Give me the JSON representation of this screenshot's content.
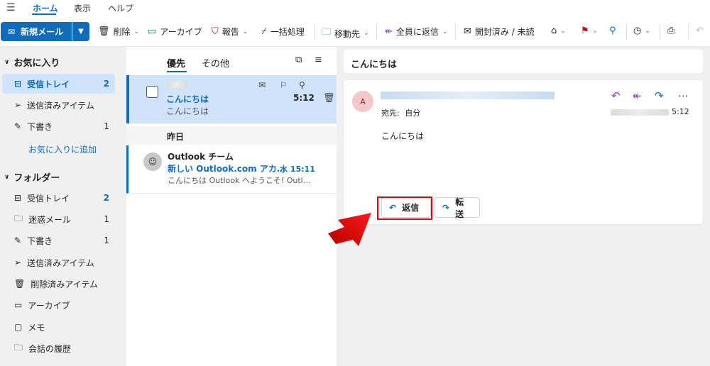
{
  "menu": {
    "tabs": [
      "ホーム",
      "表示",
      "ヘルプ"
    ]
  },
  "toolbar": {
    "new_mail": "新規メール",
    "delete": "削除",
    "archive": "アーカイブ",
    "report": "報告",
    "sweep": "一括処理",
    "move_to": "移動先",
    "reply_all": "全員に返信",
    "read_unread": "開封済み / 未読"
  },
  "sidebar": {
    "favorites_title": "お気に入り",
    "favorites": [
      {
        "label": "受信トレイ",
        "count": "2"
      },
      {
        "label": "送信済みアイテム",
        "count": ""
      },
      {
        "label": "下書き",
        "count": "1"
      }
    ],
    "add_favorite": "お気に入りに追加",
    "folders_title": "フォルダー",
    "folders": [
      {
        "label": "受信トレイ",
        "count": "2"
      },
      {
        "label": "迷惑メール",
        "count": "1"
      },
      {
        "label": "下書き",
        "count": "1"
      },
      {
        "label": "送信済みアイテム",
        "count": ""
      },
      {
        "label": "削除済みアイテム",
        "count": ""
      },
      {
        "label": "アーカイブ",
        "count": ""
      },
      {
        "label": "メモ",
        "count": ""
      },
      {
        "label": "会話の履歴",
        "count": ""
      }
    ]
  },
  "list": {
    "tab_focused": "優先",
    "tab_other": "その他",
    "msg1": {
      "subject": "こんにちは",
      "preview": "こんにちは",
      "time": "5:12"
    },
    "day_separator": "昨日",
    "msg2": {
      "sender": "Outlook チーム",
      "subject": "新しい Outlook.com アカ…",
      "time": "水 15:11",
      "preview": "こんにちは Outlook へようこそ! Outl…"
    }
  },
  "reading": {
    "subject": "こんにちは",
    "avatar_initial": "A",
    "to_label": "宛先:",
    "to_value": "自分",
    "time": "5:12",
    "body": "こんにちは",
    "reply_button": "返信",
    "forward_button": "転送"
  },
  "colors": {
    "accent": "#0f6cbd",
    "highlight": "#e60012"
  }
}
